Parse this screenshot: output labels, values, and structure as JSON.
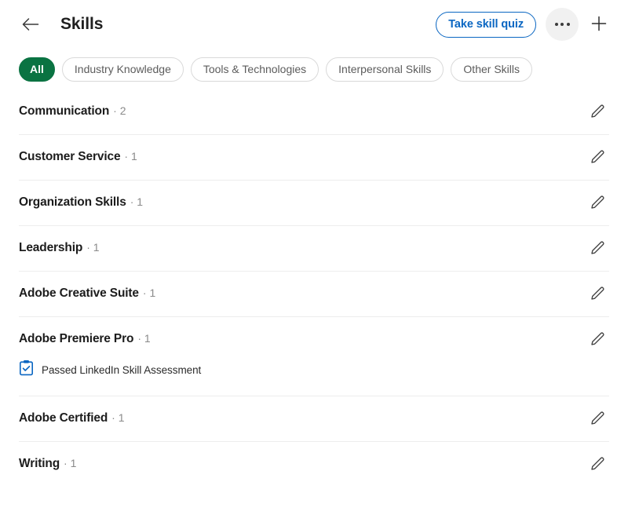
{
  "header": {
    "back_icon": "arrow-left-icon",
    "title": "Skills",
    "quiz_label": "Take skill quiz",
    "more_icon": "ellipsis-icon",
    "add_icon": "plus-icon"
  },
  "filters": {
    "chips": [
      {
        "label": "All",
        "active": true
      },
      {
        "label": "Industry Knowledge",
        "active": false
      },
      {
        "label": "Tools & Technologies",
        "active": false
      },
      {
        "label": "Interpersonal Skills",
        "active": false
      },
      {
        "label": "Other Skills",
        "active": false
      }
    ]
  },
  "skills": [
    {
      "name": "Communication",
      "count": "· 2",
      "edit_icon": "pencil-icon",
      "assessment": null
    },
    {
      "name": "Customer Service",
      "count": "· 1",
      "edit_icon": "pencil-icon",
      "assessment": null
    },
    {
      "name": "Organization Skills",
      "count": "· 1",
      "edit_icon": "pencil-icon",
      "assessment": null
    },
    {
      "name": "Leadership",
      "count": "· 1",
      "edit_icon": "pencil-icon",
      "assessment": null
    },
    {
      "name": "Adobe Creative Suite",
      "count": "· 1",
      "edit_icon": "pencil-icon",
      "assessment": null
    },
    {
      "name": "Adobe Premiere Pro",
      "count": "· 1",
      "edit_icon": "pencil-icon",
      "assessment": {
        "label": "Passed LinkedIn Skill Assessment",
        "icon": "clipboard-check-icon"
      }
    },
    {
      "name": "Adobe Certified",
      "count": "· 1",
      "edit_icon": "pencil-icon",
      "assessment": null
    },
    {
      "name": "Writing",
      "count": "· 1",
      "edit_icon": "pencil-icon",
      "assessment": null
    }
  ],
  "colors": {
    "accent_blue": "#0a66c2",
    "active_chip_green": "#0a7342",
    "text_primary": "#1c1c1c",
    "text_muted": "#8a8a8a",
    "divider": "#ededed"
  }
}
